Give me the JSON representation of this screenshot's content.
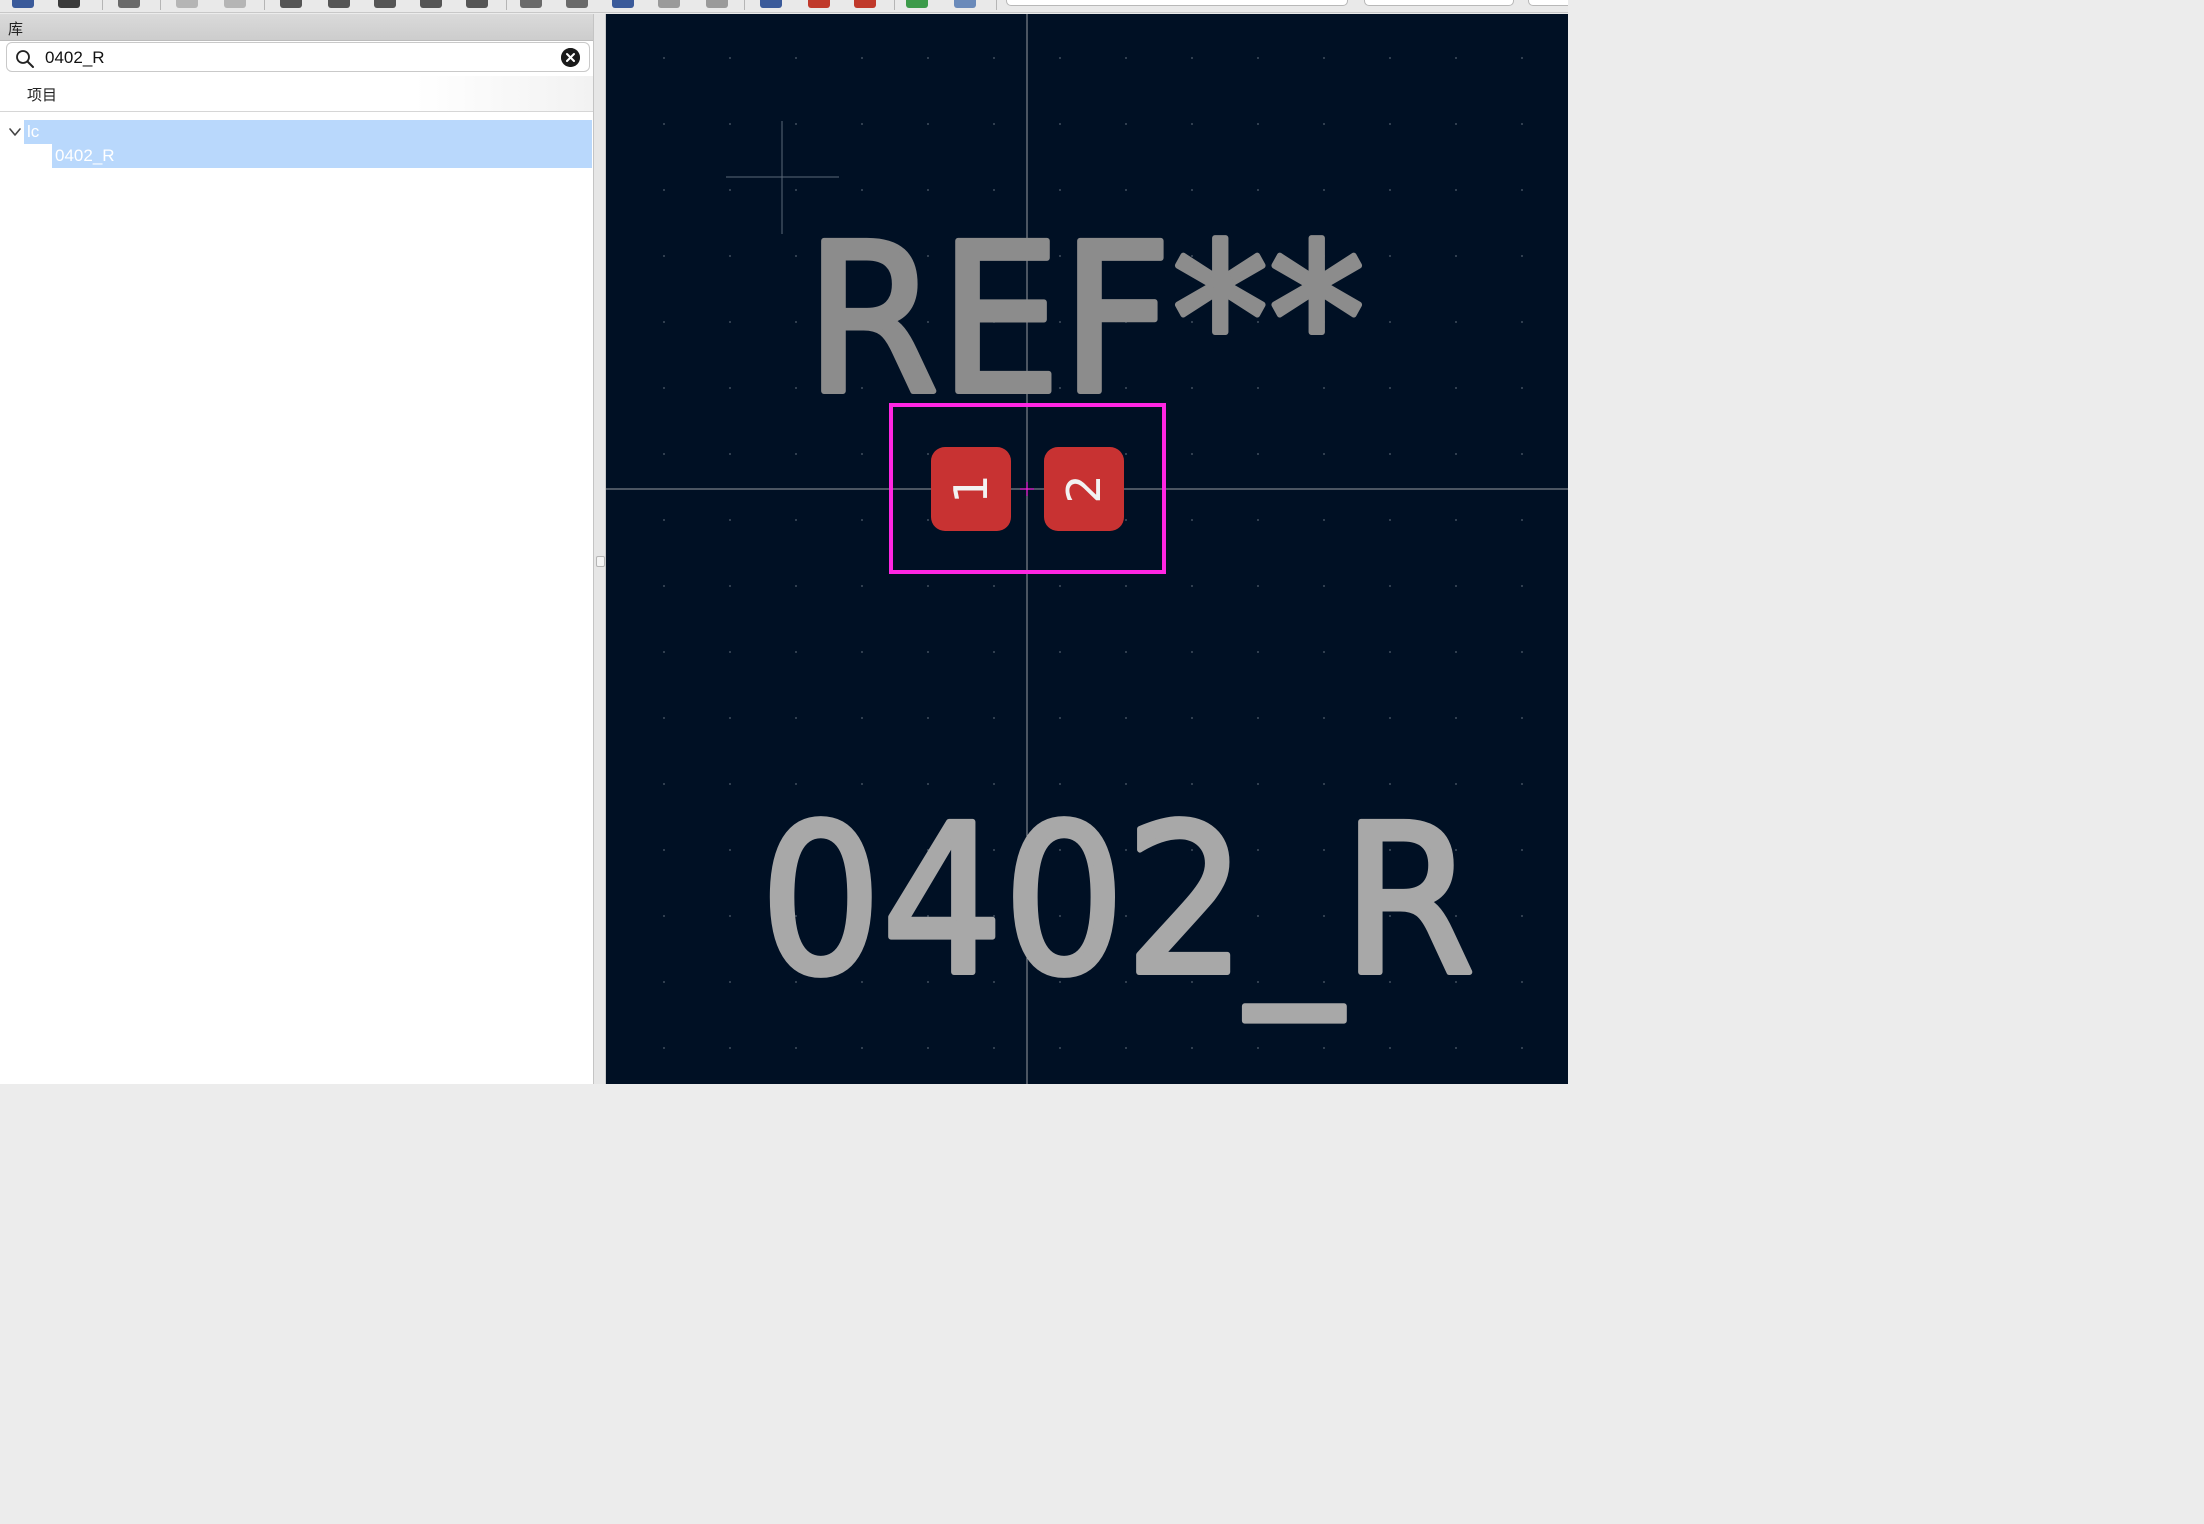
{
  "library_panel": {
    "title": "库",
    "search": {
      "value": "0402_R",
      "placeholder": ""
    },
    "column_header": "项目",
    "tree": {
      "library": {
        "name": "lc",
        "expanded": true
      },
      "footprints": [
        "0402_R"
      ]
    }
  },
  "canvas": {
    "reference_text": "REF**",
    "value_text": "0402_R",
    "pads": [
      {
        "number": "1",
        "color": "#c83232"
      },
      {
        "number": "2",
        "color": "#c83232"
      }
    ],
    "courtyard_color": "#ff26e2",
    "text_color": "#8c8c8c",
    "background_color": "#001024"
  }
}
